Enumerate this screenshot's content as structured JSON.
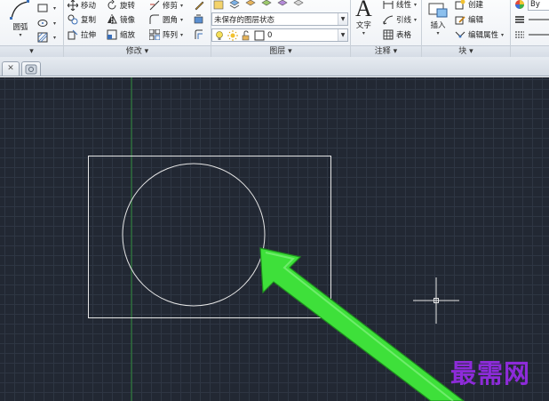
{
  "ribbon": {
    "draw": {
      "arc_label": "圆弧"
    },
    "modify": {
      "move_label": "移动",
      "rotate_label": "旋转",
      "trim_label": "修剪",
      "copy_label": "复制",
      "mirror_label": "镜像",
      "fillet_label": "圆角",
      "stretch_label": "拉伸",
      "scale_label": "缩放",
      "array_label": "阵列",
      "footer_label": "修改 ▾"
    },
    "layers": {
      "layer_state_value": "未保存的图层状态",
      "current_layer_value": "0",
      "footer_label": "图层 ▾"
    },
    "annotation": {
      "text_label": "文字",
      "linear_label": "线性",
      "leader_label": "引线",
      "table_label": "表格",
      "footer_label": "注释 ▾"
    },
    "block": {
      "insert_label": "插入",
      "create_label": "创建",
      "edit_label": "编辑",
      "edit_attributes_label": "编辑属性",
      "footer_label": "块 ▾"
    },
    "properties": {
      "bylayer_label": "By"
    }
  },
  "watermark": {
    "text": "最需网"
  },
  "colors": {
    "canvas_bg": "#222833",
    "grid": "#2e3643",
    "y_axis": "#2f8a3a",
    "geometry": "#e6e6e6",
    "arrow": "#3ee03a",
    "watermark": "#8d2bd9"
  }
}
